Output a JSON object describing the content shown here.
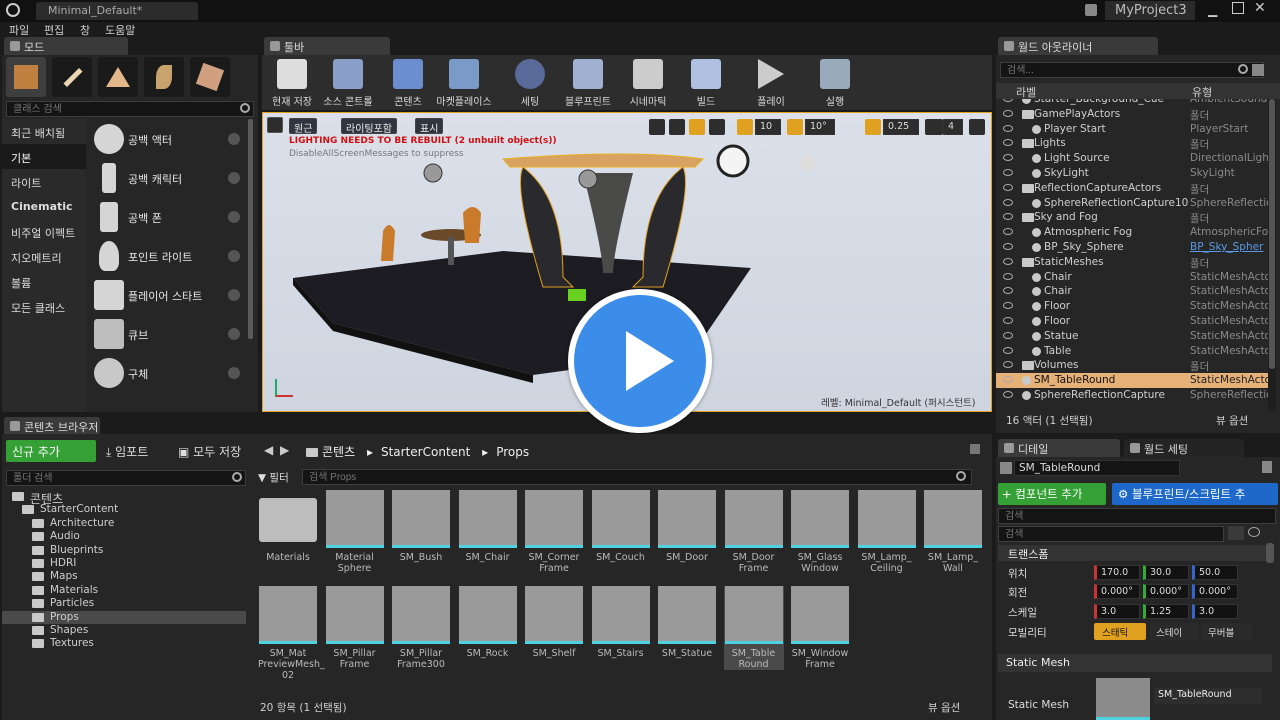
{
  "titlebar": {
    "tab_title": "Minimal_Default*",
    "project": "MyProject3"
  },
  "menu": [
    "파일",
    "편집",
    "창",
    "도움말"
  ],
  "modes": {
    "tab": "모드",
    "search_placeholder": "클래스 검색",
    "categories": [
      "최근 배치됨",
      "기본",
      "라이트",
      "Cinematic",
      "비주얼 이펙트",
      "지오메트리",
      "볼륨",
      "모든 클래스"
    ],
    "items": [
      "공백 액터",
      "공백 캐릭터",
      "공백 폰",
      "포인트 라이트",
      "플레이어 스타트",
      "큐브",
      "구체"
    ]
  },
  "toolbar": {
    "tab": "툴바",
    "buttons": [
      "현재 저장",
      "소스 콘트롤",
      "콘텐츠",
      "마켓플레이스",
      "세팅",
      "블루프린트",
      "시네마틱",
      "빌드",
      "플레이",
      "실행"
    ]
  },
  "viewport": {
    "perspective": "원근",
    "lighting": "라이팅포함",
    "show": "표시",
    "grid": "10",
    "rot": "10°",
    "scale": "0.25",
    "speed": "4",
    "warning": "LIGHTING NEEDS TO BE REBUILT (2 unbuilt object(s))",
    "disable_msg": "DisableAllScreenMessages to suppress",
    "level": "레벨:  Minimal_Default (퍼시스턴트)"
  },
  "outliner": {
    "tab": "월드 아웃라이너",
    "search_placeholder": "검색...",
    "col_label": "라벨",
    "col_type": "유형",
    "rows": [
      {
        "label": "Starter_Background_Cue",
        "type": "AmbientSound",
        "indent": 1,
        "kind": "item"
      },
      {
        "label": "GamePlayActors",
        "type": "폴더",
        "indent": 1,
        "kind": "folder"
      },
      {
        "label": "Player Start",
        "type": "PlayerStart",
        "indent": 2,
        "kind": "item"
      },
      {
        "label": "Lights",
        "type": "폴더",
        "indent": 1,
        "kind": "folder"
      },
      {
        "label": "Light Source",
        "type": "DirectionalLigh",
        "indent": 2,
        "kind": "item"
      },
      {
        "label": "SkyLight",
        "type": "SkyLight",
        "indent": 2,
        "kind": "item"
      },
      {
        "label": "ReflectionCaptureActors",
        "type": "폴더",
        "indent": 1,
        "kind": "folder"
      },
      {
        "label": "SphereReflectionCapture10",
        "type": "SphereReflectio",
        "indent": 2,
        "kind": "item"
      },
      {
        "label": "Sky and Fog",
        "type": "폴더",
        "indent": 1,
        "kind": "folder"
      },
      {
        "label": "Atmospheric Fog",
        "type": "AtmosphericFo",
        "indent": 2,
        "kind": "item"
      },
      {
        "label": "BP_Sky_Sphere",
        "type": "BP_Sky_Spher",
        "indent": 2,
        "kind": "item"
      },
      {
        "label": "StaticMeshes",
        "type": "폴더",
        "indent": 1,
        "kind": "folder"
      },
      {
        "label": "Chair",
        "type": "StaticMeshActo",
        "indent": 2,
        "kind": "item"
      },
      {
        "label": "Chair",
        "type": "StaticMeshActo",
        "indent": 2,
        "kind": "item"
      },
      {
        "label": "Floor",
        "type": "StaticMeshActo",
        "indent": 2,
        "kind": "item"
      },
      {
        "label": "Floor",
        "type": "StaticMeshActo",
        "indent": 2,
        "kind": "item"
      },
      {
        "label": "Statue",
        "type": "StaticMeshActo",
        "indent": 2,
        "kind": "item"
      },
      {
        "label": "Table",
        "type": "StaticMeshActo",
        "indent": 2,
        "kind": "item"
      },
      {
        "label": "Volumes",
        "type": "폴더",
        "indent": 1,
        "kind": "folder"
      },
      {
        "label": "SM_TableRound",
        "type": "StaticMeshActo",
        "indent": 1,
        "kind": "selected"
      },
      {
        "label": "SphereReflectionCapture",
        "type": "SphereReflectio",
        "indent": 1,
        "kind": "item"
      }
    ],
    "footer": "16 액터 (1 선택됨)",
    "view_options": "뷰 옵션"
  },
  "content": {
    "tab": "콘텐츠 브라우저",
    "add_new": "신규 추가",
    "import": "임포트",
    "save_all": "모두 저장",
    "folder_search": "폴더 검색",
    "breadcrumb": [
      "콘텐츠",
      "StarterContent",
      "Props"
    ],
    "filter": "필터",
    "search_placeholder": "검색 Props",
    "tree": [
      {
        "label": "콘텐츠",
        "indent": 0
      },
      {
        "label": "StarterContent",
        "indent": 1
      },
      {
        "label": "Architecture",
        "indent": 2
      },
      {
        "label": "Audio",
        "indent": 2
      },
      {
        "label": "Blueprints",
        "indent": 2
      },
      {
        "label": "HDRI",
        "indent": 2
      },
      {
        "label": "Maps",
        "indent": 2
      },
      {
        "label": "Materials",
        "indent": 2
      },
      {
        "label": "Particles",
        "indent": 2
      },
      {
        "label": "Props",
        "indent": 2
      },
      {
        "label": "Shapes",
        "indent": 2
      },
      {
        "label": "Textures",
        "indent": 2
      }
    ],
    "assets": [
      "Materials",
      "Material Sphere",
      "SM_Bush",
      "SM_Chair",
      "SM_Corner Frame",
      "SM_Couch",
      "SM_Door",
      "SM_Door Frame",
      "SM_Glass Window",
      "SM_Lamp_ Ceiling",
      "SM_Lamp_ Wall",
      "SM_Mat PreviewMesh_ 02",
      "SM_Pillar Frame",
      "SM_Pillar Frame300",
      "SM_Rock",
      "SM_Shelf",
      "SM_Stairs",
      "SM_Statue",
      "SM_Table Round",
      "SM_Window Frame"
    ],
    "footer": "20 항목 (1 선택됨)",
    "view_options": "뷰 옵션"
  },
  "details": {
    "tab": "디테일",
    "world_settings": "월드 세팅",
    "name": "SM_TableRound",
    "add_component": "+ 컴포넌트 추가",
    "blueprint_script": "블루프린트/스크립트 추",
    "search_placeholder": "검색",
    "transform": "트랜스폼",
    "location_label": "위치",
    "rotation_label": "회전",
    "scale_label": "스케일",
    "mobility_label": "모빌리티",
    "location": [
      "170.0",
      "30.0",
      "50.0"
    ],
    "rotation": [
      "0.000°",
      "0.000°",
      "0.000°"
    ],
    "scale": [
      "3.0",
      "1.25",
      "3.0"
    ],
    "mobility": [
      "스태틱",
      "스테이",
      "무버블"
    ],
    "static_mesh_section": "Static Mesh",
    "static_mesh_label": "Static Mesh",
    "mesh_value": "SM_TableRound"
  }
}
